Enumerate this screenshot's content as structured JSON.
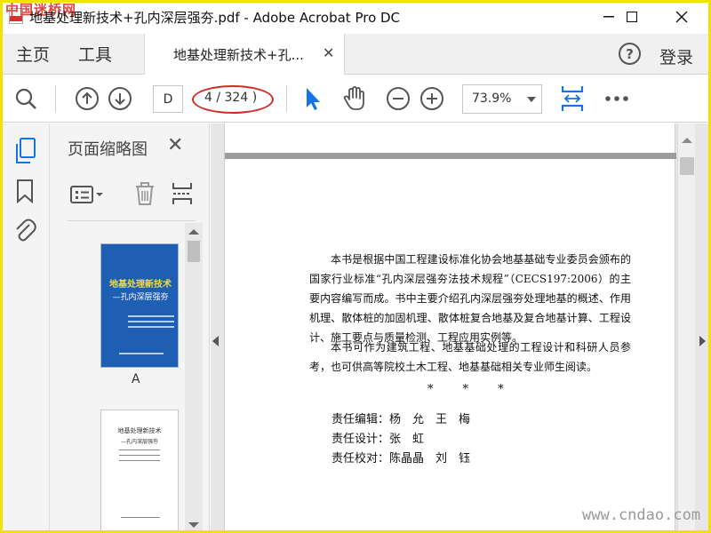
{
  "window": {
    "title": "地基处理新技术+孔内深层强夯.pdf - Adobe Acrobat Pro DC",
    "watermark": "中国迷桥网"
  },
  "tabs": {
    "home": "主页",
    "tools": "工具",
    "doc_tab": "地基处理新技术+孔...",
    "login": "登录"
  },
  "toolbar": {
    "page_input": "D",
    "page_count": "4 / 324 )",
    "zoom": "73.9%"
  },
  "thumbnail_panel": {
    "title": "页面缩略图",
    "thumbs": [
      {
        "label": "A",
        "cover_title": "地基处理新技术",
        "cover_subtitle": "—孔内深层强夯"
      },
      {
        "title": "地基处理新技术",
        "subtitle": "—孔内深层强夯"
      }
    ]
  },
  "document": {
    "paragraph1": "本书是根据中国工程建设标准化协会地基基础专业委员会颁布的国家行业标准“孔内深层强夯法技术规程”（CECS197:2006）的主要内容编写而成。书中主要介绍孔内深层强夯处理地基的概述、作用机理、散体桩的加固机理、散体桩复合地基及复合地基计算、工程设计、施工要点与质量检测、工程应用实例等。",
    "paragraph2": "本书可作为建筑工程、地基基础处理的工程设计和科研人员参考，也可供高等院校土木工程、地基基础相关专业师生阅读。",
    "stars": "*        *        *",
    "credits": [
      "责任编辑：杨　允　王　梅",
      "责任设计：张　虹",
      "责任校对：陈晶晶　刘　钰"
    ]
  },
  "watermark_url": "www.cndao.com",
  "colors": {
    "accent_blue": "#1473e6",
    "highlight_red": "#d52b24",
    "border_yellow": "#f2e200"
  }
}
